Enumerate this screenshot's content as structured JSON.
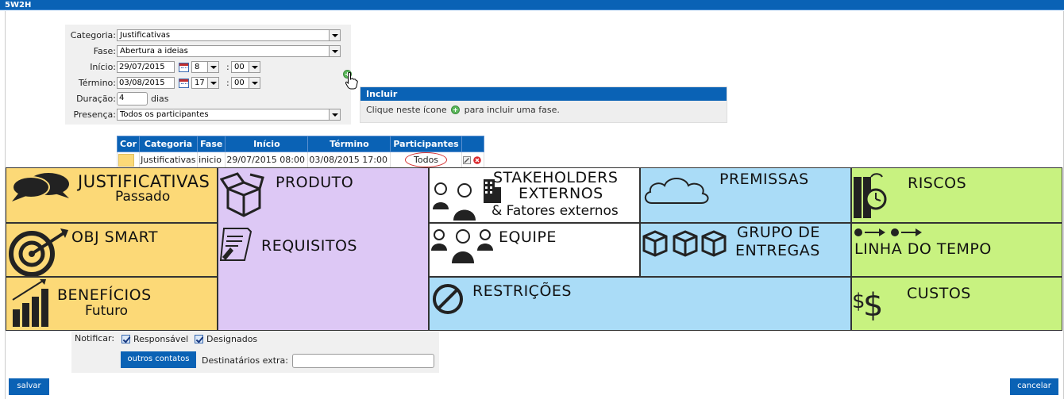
{
  "window_title": "5W2H",
  "form": {
    "categoria_label": "Categoria:",
    "categoria_value": "Justificativas",
    "fase_label": "Fase:",
    "fase_value": "Abertura a ideias",
    "inicio_label": "Início:",
    "inicio_date": "29/07/2015",
    "inicio_hour": "8",
    "inicio_min": "00",
    "termino_label": "Término:",
    "termino_date": "03/08/2015",
    "termino_hour": "17",
    "termino_min": "00",
    "colon": ":",
    "duracao_label": "Duração:",
    "duracao_value": "4",
    "dias_label": "dias",
    "presenca_label": "Presença:",
    "presenca_value": "Todos os participantes"
  },
  "tooltip": {
    "title": "Incluir",
    "text_before": "Clique neste ícone",
    "text_after": "para incluir uma fase."
  },
  "table": {
    "headers": [
      "Cor",
      "Categoria",
      "Fase",
      "Início",
      "Término",
      "Participantes",
      ""
    ],
    "row": {
      "color": "#fcd977",
      "categoria": "Justificativas",
      "fase": "inicio",
      "inicio": "29/07/2015 08:00",
      "termino": "03/08/2015 17:00",
      "participantes": "Todos"
    }
  },
  "board": {
    "justificativas": "JUSTIFICATIVAS",
    "passado": "Passado",
    "produto": "PRODUTO",
    "stakeholders_1": "STAKEHOLDERS",
    "stakeholders_2": "EXTERNOS",
    "stakeholders_3": "& Fatores externos",
    "premissas": "PREMISSAS",
    "riscos": "RISCOS",
    "obj_smart": "OBJ SMART",
    "requisitos": "REQUISITOS",
    "equipe": "EQUIPE",
    "grupo_1": "GRUPO DE",
    "grupo_2": "ENTREGAS",
    "linha_tempo": "LINHA DO TEMPO",
    "beneficios": "BENEFÍCIOS",
    "futuro": "Futuro",
    "restricoes": "RESTRIÇÕES",
    "custos": "CUSTOS"
  },
  "notify": {
    "label": "Notificar:",
    "responsavel": "Responsável",
    "designados": "Designados",
    "outros_contatos": "outros contatos",
    "destinatarios_label": "Destinatários extra:"
  },
  "actions": {
    "salvar": "salvar",
    "cancelar": "cancelar"
  }
}
